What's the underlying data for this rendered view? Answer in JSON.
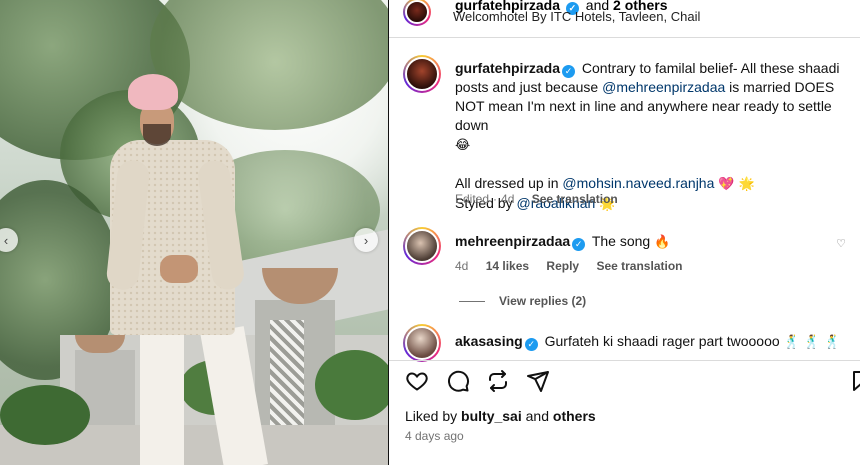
{
  "post": {
    "header": {
      "username": "gurfatehpirzada",
      "and_text": "and",
      "others_text": "2 others",
      "location": "Welcomhotel By ITC Hotels, Tavleen, Chail"
    },
    "caption": {
      "username": "gurfatehpirzada",
      "text_1": "Contrary to familal belief- All these shaadi posts and just because",
      "mention_1": "@mehreenpirzadaa",
      "text_2": "is married DOES NOT mean I'm next in line and anywhere near ready to settle down",
      "emoji_1": "😂",
      "line2_prefix": "All dressed up in",
      "mention_2": "@mohsin.naveed.ranjha",
      "emoji_2": "💖 🌟",
      "line3_prefix": "Styled by",
      "mention_3": "@raoalikhan",
      "emoji_3": "🌟",
      "edited": "Edited",
      "time": "4d",
      "see_translation": "See translation"
    },
    "comments": [
      {
        "username": "mehreenpirzadaa",
        "text": "The song",
        "emoji": "🔥",
        "time": "4d",
        "likes": "14 likes",
        "reply": "Reply",
        "see_translation": "See translation",
        "view_replies": "View replies (2)"
      },
      {
        "username": "akasasing",
        "text": "Gurfateh ki shaadi rager part twooooo",
        "emoji": "🕺 🕺 🕺"
      }
    ],
    "footer": {
      "liked_by_prefix": "Liked by",
      "liked_by_user": "bulty_sai",
      "liked_by_and": "and",
      "liked_by_others": "others",
      "posted_ago": "4 days ago"
    }
  },
  "icons": {
    "like": "heart-icon",
    "comment": "comment-icon",
    "share": "repost-icon",
    "send": "send-icon",
    "save": "bookmark-icon",
    "prev": "chevron-left-icon",
    "next": "chevron-right-icon"
  },
  "colors": {
    "mention": "#00376b",
    "verified": "#1d9bf0",
    "secondary_text": "#737373",
    "divider": "#dbdbdb"
  }
}
